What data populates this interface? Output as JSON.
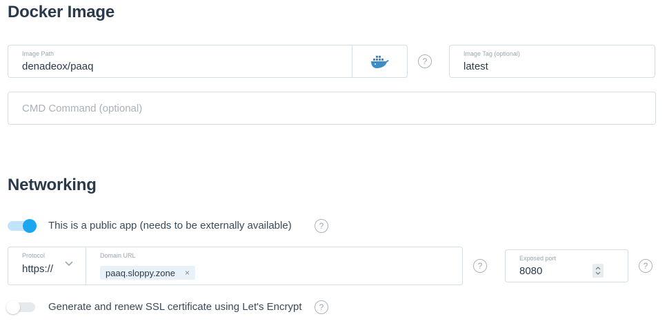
{
  "docker": {
    "title": "Docker Image",
    "image_path": {
      "label": "Image Path",
      "value": "denadeox/paaq"
    },
    "image_tag": {
      "label": "Image Tag (optional)",
      "value": "latest"
    },
    "cmd": {
      "placeholder": "CMD Command (optional)"
    },
    "help": "?"
  },
  "networking": {
    "title": "Networking",
    "public_app": {
      "label": "This is a public app (needs to be externally available)",
      "on": true
    },
    "protocol": {
      "label": "Protocol",
      "value": "https://"
    },
    "domain": {
      "label": "Domain URL",
      "chip": "paaq.sloppy.zone",
      "remove": "×"
    },
    "port": {
      "label": "Exposed port",
      "value": "8080"
    },
    "ssl": {
      "label": "Generate and renew SSL certificate using Let's Encrypt",
      "on": false
    },
    "help": "?"
  },
  "colors": {
    "accent": "#1ba6ef",
    "accent_track": "#bfe4fb",
    "border": "#d6dde3",
    "heading": "#2b3a4a"
  },
  "icons": {
    "docker": "docker-whale-icon",
    "protocol_chevron": "chevron-down-icon",
    "port_stepper": "stepper-arrows-icon"
  }
}
